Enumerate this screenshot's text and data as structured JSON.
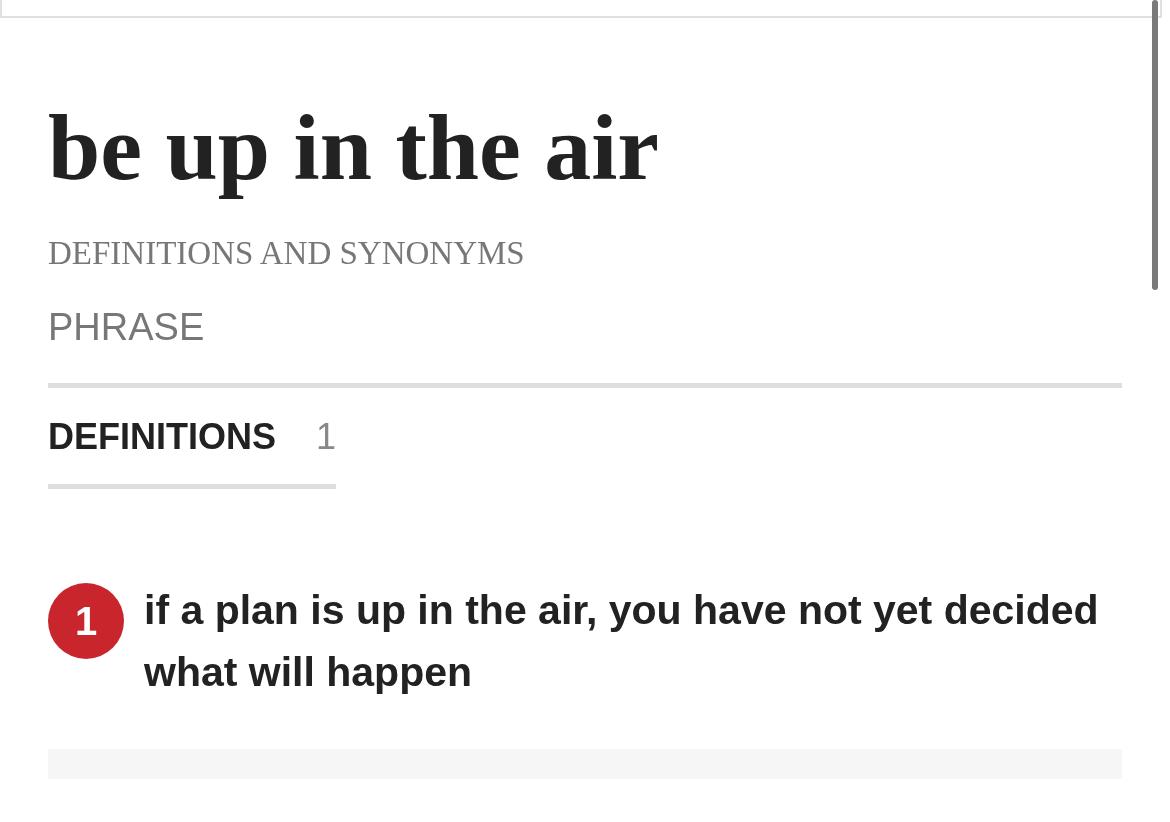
{
  "entry": {
    "headword": "be up in the air",
    "subtitle": "DEFINITIONS AND SYNONYMS",
    "part_of_speech": "PHRASE"
  },
  "tabs": [
    {
      "label": "DEFINITIONS",
      "count": "1",
      "selected": true
    }
  ],
  "definitions": [
    {
      "number": "1",
      "text": "if a plan is up in the air, you have not yet decided what will happen"
    }
  ]
}
